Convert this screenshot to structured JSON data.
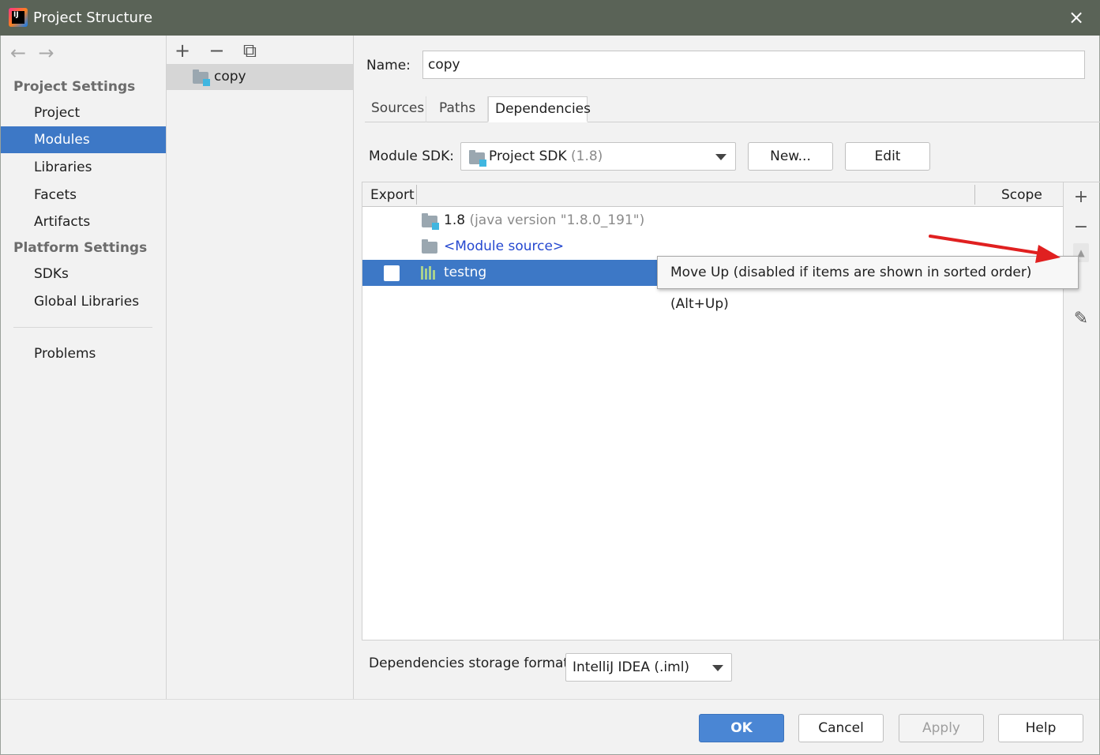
{
  "window": {
    "title": "Project Structure",
    "close_icon": "×"
  },
  "nav": {
    "back": "←",
    "forward": "→"
  },
  "sidebar": {
    "project_settings_header": "Project Settings",
    "project_items": [
      "Project",
      "Modules",
      "Libraries",
      "Facets",
      "Artifacts"
    ],
    "platform_settings_header": "Platform Settings",
    "platform_items": [
      "SDKs",
      "Global Libraries"
    ],
    "problems": "Problems",
    "active_item": "Modules"
  },
  "modules": {
    "toolbar": {
      "add": "+",
      "remove": "−",
      "copy": "⧉"
    },
    "items": [
      {
        "name": "copy"
      }
    ]
  },
  "module": {
    "name_label": "Name:",
    "name_value": "copy",
    "tabs": [
      "Sources",
      "Paths",
      "Dependencies"
    ],
    "active_tab": "Dependencies",
    "sdk_label": "Module SDK:",
    "sdk_value": "Project SDK",
    "sdk_version": "(1.8)",
    "new_button": "New...",
    "edit_button": "Edit",
    "table": {
      "col_export": "Export",
      "col_scope": "Scope",
      "rows": [
        {
          "name": "1.8",
          "detail": "(java version \"1.8.0_191\")",
          "type": "sdk"
        },
        {
          "name": "<Module source>",
          "type": "source"
        },
        {
          "name": "testng",
          "type": "library",
          "export": false,
          "selected": true
        }
      ]
    },
    "side_tools": {
      "add": "+",
      "remove": "−",
      "edit": "✎"
    },
    "storage_label": "Dependencies storage format:",
    "storage_value": "IntelliJ IDEA (.iml)"
  },
  "tooltip": "Move Up (disabled if items are shown in sorted order) (Alt+Up)",
  "buttons": {
    "ok": "OK",
    "cancel": "Cancel",
    "apply": "Apply",
    "help": "Help"
  },
  "colors": {
    "selection": "#3d78c6",
    "titlebar": "#5a6357",
    "link": "#2548d0",
    "annotation_arrow": "#e02020"
  }
}
